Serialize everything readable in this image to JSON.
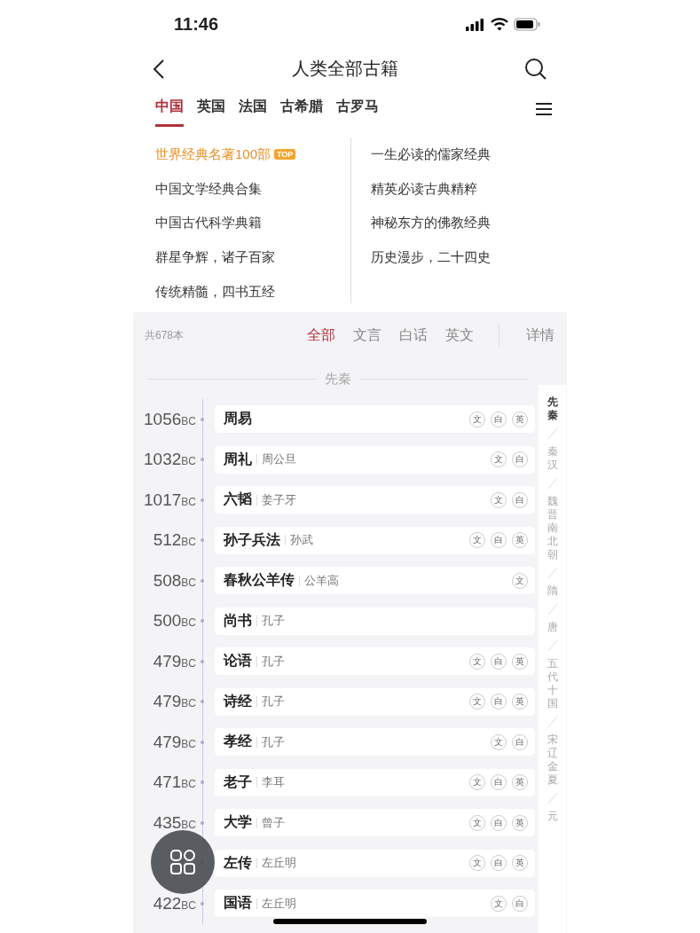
{
  "status_bar": {
    "time": "11:46"
  },
  "nav": {
    "title": "人类全部古籍"
  },
  "tabs": [
    {
      "label": "中国",
      "selected": true
    },
    {
      "label": "英国",
      "selected": false
    },
    {
      "label": "法国",
      "selected": false
    },
    {
      "label": "古希腊",
      "selected": false
    },
    {
      "label": "古罗马",
      "selected": false
    }
  ],
  "collections": {
    "column_1": [
      {
        "label": "世界经典名著100部",
        "featured": true,
        "badge": "TOP"
      },
      {
        "label": "中国文学经典合集",
        "featured": false
      },
      {
        "label": "中国古代科学典籍",
        "featured": false
      },
      {
        "label": "群星争辉，诸子百家",
        "featured": false
      },
      {
        "label": "传统精髓，四书五经",
        "featured": false
      }
    ],
    "column_2": [
      {
        "label": "一生必读的儒家经典",
        "featured": false
      },
      {
        "label": "精英必读古典精粹",
        "featured": false
      },
      {
        "label": "神秘东方的佛教经典",
        "featured": false
      },
      {
        "label": "历史漫步，二十四史",
        "featured": false
      }
    ]
  },
  "list": {
    "count": "共678本",
    "filters": [
      {
        "label": "全部",
        "selected": true
      },
      {
        "label": "文言",
        "selected": false
      },
      {
        "label": "白话",
        "selected": false
      },
      {
        "label": "英文",
        "selected": false
      }
    ],
    "details": "详情",
    "section": "先秦",
    "books": [
      {
        "year": "1056",
        "unit": "BC",
        "title": "周易",
        "badges": [
          "文",
          "白",
          "英"
        ]
      },
      {
        "year": "1032",
        "unit": "BC",
        "title": "周礼",
        "author": "周公旦",
        "badges": [
          "文",
          "白"
        ]
      },
      {
        "year": "1017",
        "unit": "BC",
        "title": "六韬",
        "author": "姜子牙",
        "badges": [
          "文",
          "白"
        ]
      },
      {
        "year": "512",
        "unit": "BC",
        "title": "孙子兵法",
        "author": "孙武",
        "badges": [
          "文",
          "白",
          "英"
        ]
      },
      {
        "year": "508",
        "unit": "BC",
        "title": "春秋公羊传",
        "author": "公羊高",
        "badges": [
          "文"
        ]
      },
      {
        "year": "500",
        "unit": "BC",
        "title": "尚书",
        "author": "孔子"
      },
      {
        "year": "479",
        "unit": "BC",
        "title": "论语",
        "author": "孔子",
        "badges": [
          "文",
          "白",
          "英"
        ]
      },
      {
        "year": "479",
        "unit": "BC",
        "title": "诗经",
        "author": "孔子",
        "badges": [
          "文",
          "白",
          "英"
        ]
      },
      {
        "year": "479",
        "unit": "BC",
        "title": "孝经",
        "author": "孔子",
        "badges": [
          "文",
          "白"
        ]
      },
      {
        "year": "471",
        "unit": "BC",
        "title": "老子",
        "author": "李耳",
        "badges": [
          "文",
          "白",
          "英"
        ]
      },
      {
        "year": "435",
        "unit": "BC",
        "title": "大学",
        "author": "曾子",
        "badges": [
          "文",
          "白",
          "英"
        ]
      },
      {
        "title": "左传",
        "author": "左丘明",
        "badges": [
          "文",
          "白",
          "英"
        ]
      },
      {
        "year": "422",
        "unit": "BC",
        "title": "国语",
        "author": "左丘明",
        "badges": [
          "文",
          "白"
        ]
      }
    ],
    "eras": [
      {
        "label": "先秦",
        "selected": true
      },
      {
        "label": "秦汉",
        "selected": false
      },
      {
        "label": "魏晋南北朝",
        "selected": false
      },
      {
        "label": "隋",
        "selected": false
      },
      {
        "label": "唐",
        "selected": false
      },
      {
        "label": "五代十国",
        "selected": false
      },
      {
        "label": "宋辽金夏",
        "selected": false
      },
      {
        "label": "元",
        "selected": false
      }
    ]
  }
}
